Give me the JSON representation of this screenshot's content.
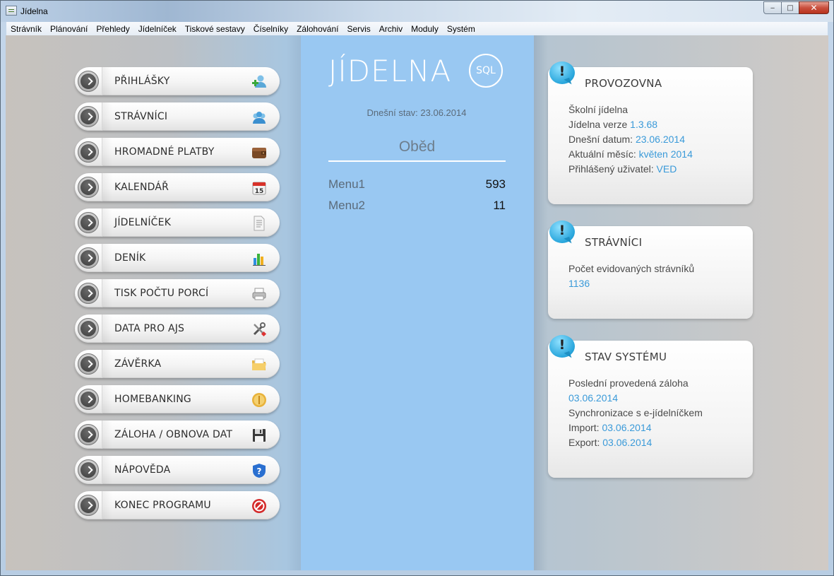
{
  "window": {
    "title": "Jídelna",
    "controls": {
      "minimize": "‒",
      "maximize": "□",
      "close": "✕"
    }
  },
  "menu": [
    "Strávník",
    "Plánování",
    "Přehledy",
    "Jídelníček",
    "Tiskové sestavy",
    "Číselníky",
    "Zálohování",
    "Servis",
    "Archiv",
    "Moduly",
    "Systém"
  ],
  "nav": [
    {
      "label": "PŘIHLÁŠKY",
      "icon": "add-user-icon"
    },
    {
      "label": "STRÁVNÍCI",
      "icon": "users-icon"
    },
    {
      "label": "HROMADNÉ PLATBY",
      "icon": "wallet-icon"
    },
    {
      "label": "KALENDÁŘ",
      "icon": "calendar-icon"
    },
    {
      "label": "JÍDELNÍČEK",
      "icon": "document-icon"
    },
    {
      "label": "DENÍK",
      "icon": "bar-chart-icon"
    },
    {
      "label": "TISK POČTU PORCÍ",
      "icon": "printer-icon"
    },
    {
      "label": "DATA PRO AJS",
      "icon": "tools-icon"
    },
    {
      "label": "ZÁVĚRKA",
      "icon": "folder-icon"
    },
    {
      "label": "HOMEBANKING",
      "icon": "coin-icon"
    },
    {
      "label": "ZÁLOHA / OBNOVA DAT",
      "icon": "floppy-disk-icon"
    },
    {
      "label": "NÁPOVĚDA",
      "icon": "help-shield-icon"
    },
    {
      "label": "KONEC PROGRAMU",
      "icon": "stop-icon"
    }
  ],
  "center": {
    "logo": "JÍDELNA",
    "logo_badge": "SQL",
    "today": "Dnešní stav: 23.06.2014",
    "meal": "Oběd",
    "menus": [
      {
        "name": "Menu1",
        "count": "593"
      },
      {
        "name": "Menu2",
        "count": "11"
      }
    ]
  },
  "cards": {
    "provozovna": {
      "title": "PROVOZOVNA",
      "school": "Školní jídelna",
      "version_label": "Jídelna verze ",
      "version": "1.3.68",
      "date_label": "Dnešní datum: ",
      "date": "23.06.2014",
      "month_label": "Aktuální měsíc: ",
      "month": "květen 2014",
      "user_label": "Přihlášený uživatel: ",
      "user": "VED"
    },
    "stravnici": {
      "title": "STRÁVNÍCI",
      "count_label": "Počet evidovaných strávníků",
      "count": "1136"
    },
    "stav": {
      "title": "STAV SYSTÉMU",
      "backup_label": "Poslední provedená záloha",
      "backup": "03.06.2014",
      "sync_label": "Synchronizace s e-jídelníčkem",
      "import_label": "Import: ",
      "import": "03.06.2014",
      "export_label": "Export: ",
      "export": "03.06.2014"
    }
  },
  "colors": {
    "panel": "#99c8f2",
    "link": "#3a9ad9",
    "bubble": "#28a6dc"
  }
}
